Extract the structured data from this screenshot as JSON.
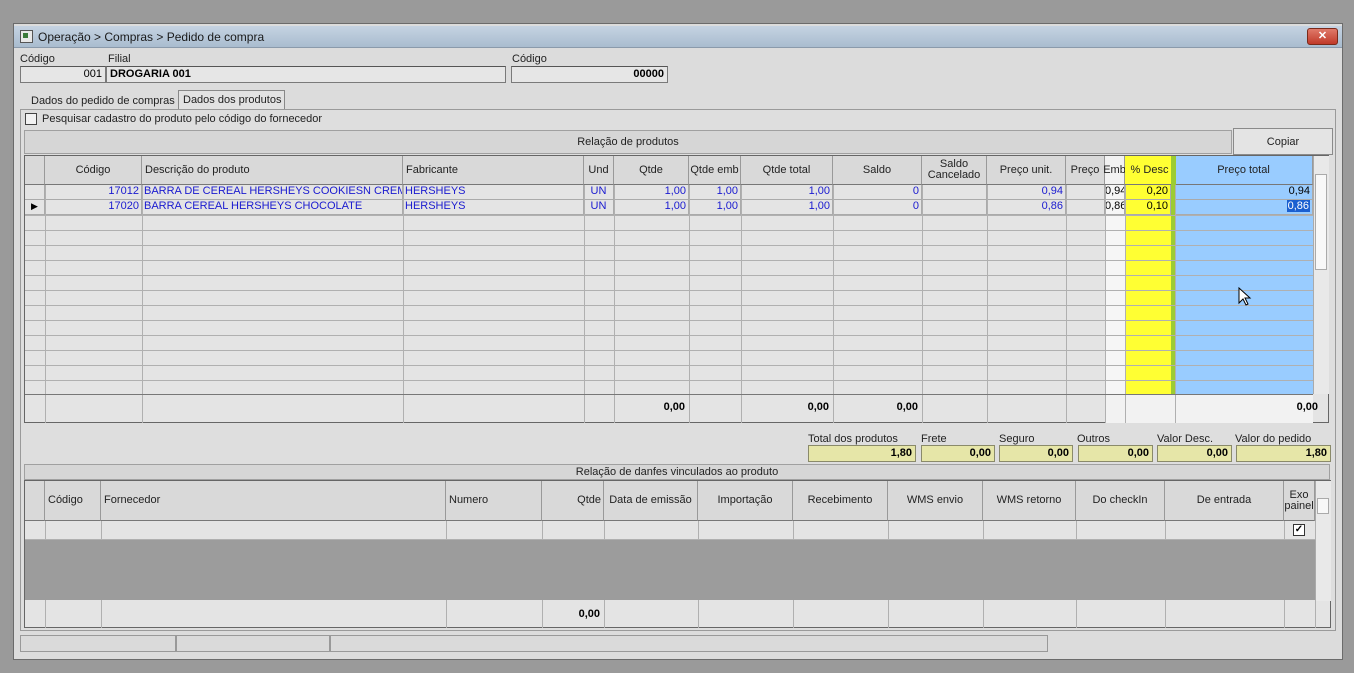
{
  "window": {
    "title": "Operação > Compras > Pedido de compra",
    "close_label": "✕"
  },
  "header": {
    "codigo_label": "Código",
    "codigo_value": "001",
    "filial_label": "Filial",
    "filial_value": "DROGARIA 001",
    "codigo2_label": "Código",
    "codigo2_value": "00000"
  },
  "tabs": [
    {
      "label": "Dados do pedido de compras"
    },
    {
      "label": "Dados dos produtos"
    }
  ],
  "search_checkbox_label": "Pesquisar cadastro do produto pelo código do fornecedor",
  "products": {
    "section_title": "Relação de produtos",
    "copy_button": "Copiar",
    "columns": [
      "Código",
      "Descrição do produto",
      "Fabricante",
      "Und",
      "Qtde",
      "Qtde emb",
      "Qtde total",
      "Saldo",
      "Saldo Cancelado",
      "Preço unit.",
      "Preço",
      "Emb",
      "% Desc",
      "Preço total"
    ],
    "rows": [
      {
        "codigo": "17012",
        "descricao": "BARRA DE CEREAL HERSHEYS COOKIESN CREME",
        "fabricante": "HERSHEYS",
        "und": "UN",
        "qtde": "1,00",
        "qtde_emb": "1,00",
        "qtde_total": "1,00",
        "saldo": "0",
        "saldo_cancelado": "",
        "preco_unit": "0,94",
        "emb": "0,94",
        "desc": "0,20",
        "preco_total": "0,94"
      },
      {
        "codigo": "17020",
        "descricao": "BARRA CEREAL HERSHEYS CHOCOLATE",
        "fabricante": "HERSHEYS",
        "und": "UN",
        "qtde": "1,00",
        "qtde_emb": "1,00",
        "qtde_total": "1,00",
        "saldo": "0",
        "saldo_cancelado": "",
        "preco_unit": "0,86",
        "emb": "0,86",
        "desc": "0,10",
        "preco_total": "0,86"
      }
    ],
    "totals": {
      "qtde": "0,00",
      "qtde_total": "0,00",
      "saldo": "0,00",
      "preco_total": "0,00"
    }
  },
  "summary": {
    "total_produtos_label": "Total dos produtos",
    "total_produtos": "1,80",
    "frete_label": "Frete",
    "frete": "0,00",
    "seguro_label": "Seguro",
    "seguro": "0,00",
    "outros_label": "Outros",
    "outros": "0,00",
    "valor_desc_label": "Valor Desc.",
    "valor_desc": "0,00",
    "valor_pedido_label": "Valor do pedido",
    "valor_pedido": "1,80"
  },
  "danfes": {
    "section_title": "Relação de danfes vinculados ao produto",
    "columns": [
      "Código",
      "Fornecedor",
      "Numero",
      "Qtde",
      "Data de emissão",
      "Importação",
      "Recebimento",
      "WMS envio",
      "WMS retorno",
      "Do checkIn",
      "De entrada",
      "Exo painel"
    ],
    "total_qtde": "0,00"
  },
  "colors": {
    "yellow_col": "#ffff33",
    "blue_col": "#99ccff",
    "link_text": "#1a1ad0"
  }
}
